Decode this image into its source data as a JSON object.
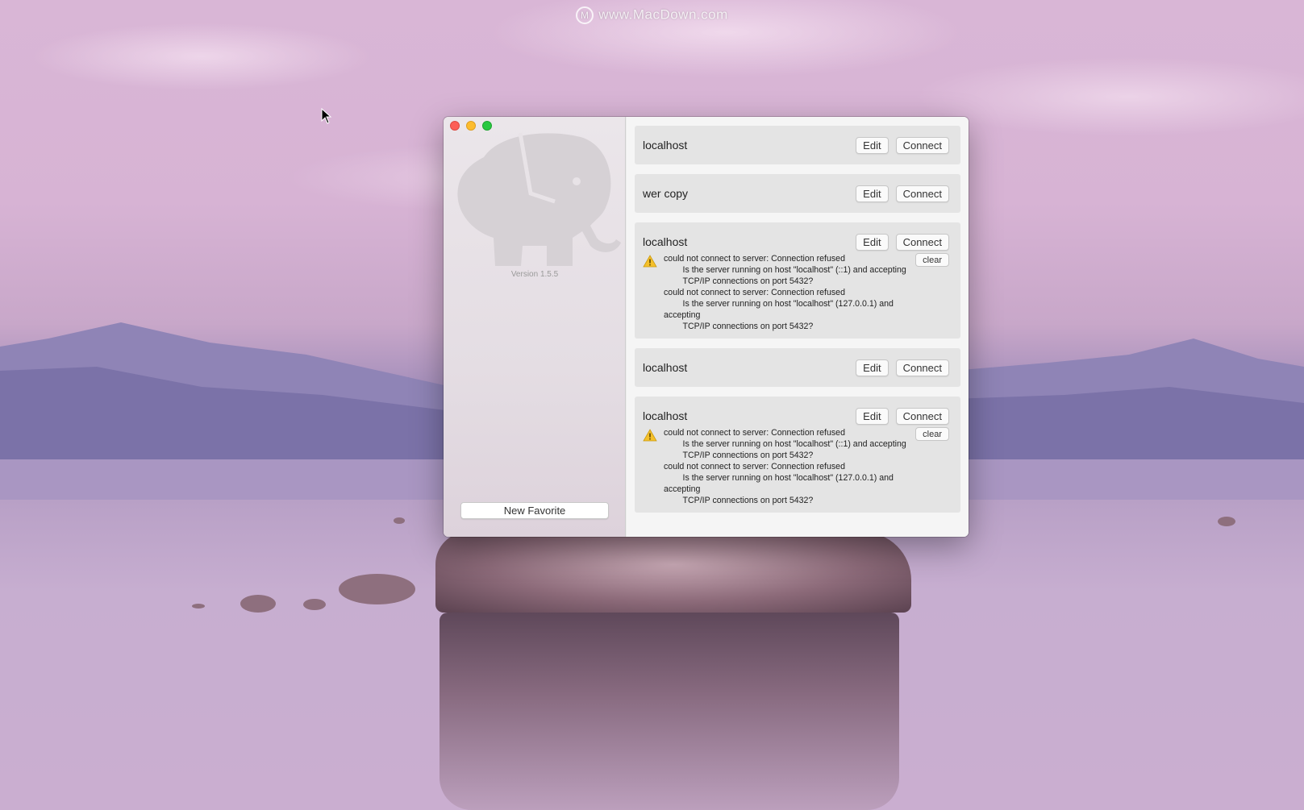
{
  "desktop": {
    "watermark": "www.MacDown.com",
    "watermark_logo_text": "M"
  },
  "window": {
    "sidebar": {
      "version": "Version 1.5.5",
      "new_favorite_label": "New Favorite"
    },
    "favorites": [
      {
        "name": "localhost",
        "edit_label": "Edit",
        "connect_label": "Connect",
        "error": null
      },
      {
        "name": "wer copy",
        "edit_label": "Edit",
        "connect_label": "Connect",
        "error": null
      },
      {
        "name": "localhost",
        "edit_label": "Edit",
        "connect_label": "Connect",
        "error": "could not connect to server: Connection refused\n\tIs the server running on host \"localhost\" (::1) and accepting\n\tTCP/IP connections on port 5432?\ncould not connect to server: Connection refused\n\tIs the server running on host \"localhost\" (127.0.0.1) and accepting\n\tTCP/IP connections on port 5432?",
        "clear_label": "clear"
      },
      {
        "name": "localhost",
        "edit_label": "Edit",
        "connect_label": "Connect",
        "error": null
      },
      {
        "name": "localhost",
        "edit_label": "Edit",
        "connect_label": "Connect",
        "error": "could not connect to server: Connection refused\n\tIs the server running on host \"localhost\" (::1) and accepting\n\tTCP/IP connections on port 5432?\ncould not connect to server: Connection refused\n\tIs the server running on host \"localhost\" (127.0.0.1) and accepting\n\tTCP/IP connections on port 5432?",
        "clear_label": "clear"
      }
    ]
  },
  "colors": {
    "close": "#fc5f57",
    "minimize": "#fdbc2e",
    "zoom": "#28c840",
    "warning": "#f5c02a"
  }
}
